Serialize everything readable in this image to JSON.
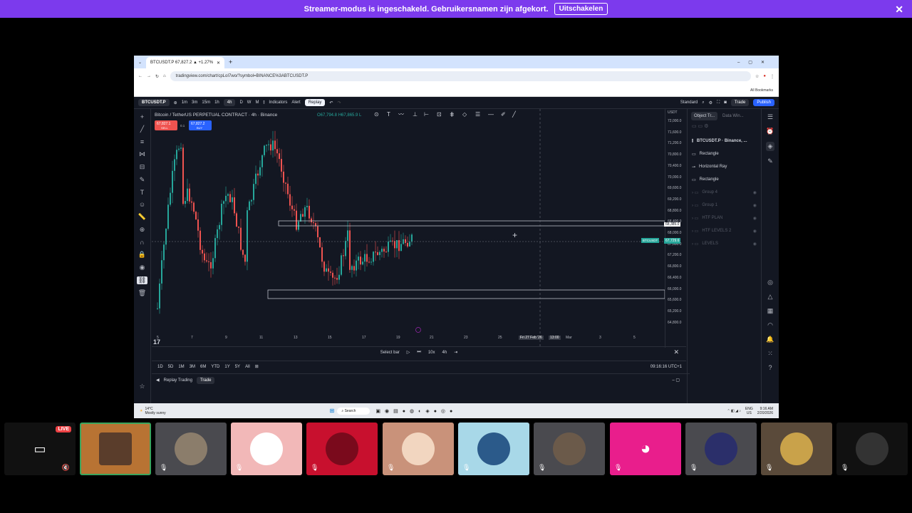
{
  "banner": {
    "text": "Streamer-modus is ingeschakeld. Gebruikersnamen zijn afgekort.",
    "button": "Uitschakelen"
  },
  "browser": {
    "tab_title": "BTCUSDT.P 67,827.2 ▲ +1.27%",
    "url": "tradingview.com/chart/cpLoI7wo/?symbol=BINANCE%3ABTCUSDT.P",
    "bookmarks": "All Bookmarks"
  },
  "toolbar": {
    "symbol": "BTCUSDT.P",
    "intervals": [
      "1m",
      "3m",
      "15m",
      "1h",
      "4h",
      "D",
      "W",
      "M"
    ],
    "indicators": "Indicators",
    "alert": "Alert",
    "replay": "Replay",
    "layout": "Standard",
    "trade": "Trade",
    "publish": "Publish"
  },
  "chart": {
    "title": "Bitcoin / TetherUS PERPETUAL CONTRACT · 4h · Binance",
    "ohlc": "O67,794.8 H67,865.9 L",
    "sell_price": "67,827.1",
    "sell_label": "SELL",
    "spread": "0.1",
    "buy_price": "67,827.2",
    "buy_label": "BUY",
    "currency": "USDT",
    "marker_price": "68,385.0",
    "current_price": "67,729.6",
    "current_symbol": "BTCUSDT",
    "crosshair_date": "Fri 27 Feb '26",
    "crosshair_time": "13:00"
  },
  "price_ticks": [
    "72,000.0",
    "71,600.0",
    "71,200.0",
    "70,800.0",
    "70,400.0",
    "70,000.0",
    "69,600.0",
    "69,200.0",
    "68,800.0",
    "68,400.0",
    "68,000.0",
    "67,600.0",
    "67,200.0",
    "66,800.0",
    "66,400.0",
    "66,000.0",
    "65,600.0",
    "65,200.0",
    "64,800.0"
  ],
  "time_ticks": [
    "5",
    "7",
    "9",
    "11",
    "13",
    "15",
    "17",
    "19",
    "21",
    "23",
    "25",
    "Mar",
    "3",
    "5"
  ],
  "replay": {
    "select_bar": "Select bar",
    "speed": "10x",
    "interval": "4h"
  },
  "ranges": [
    "1D",
    "5D",
    "1M",
    "3M",
    "6M",
    "YTD",
    "1Y",
    "5Y",
    "All"
  ],
  "clock": "09:16:16 UTC+1",
  "bottom_panel": {
    "label": "Replay Trading",
    "button": "Trade"
  },
  "object_tree": {
    "tabs": [
      "Object Tr...",
      "Data Win..."
    ],
    "header": "BTCUSDT.P · Binance, ...",
    "items": [
      "Rectangle",
      "Horizontal Ray",
      "Rectangle"
    ],
    "groups": [
      "Group 4",
      "Group 1",
      "HTF PLAN",
      "HTF LEVELS 2",
      "LEVELS"
    ]
  },
  "taskbar": {
    "temp": "14°C",
    "weather": "Mostly sunny",
    "search": "Search",
    "lang": "ENG",
    "region": "US",
    "time": "9:16 AM",
    "date": "2/20/2026"
  },
  "discord": {
    "live": "LIVE"
  },
  "colors": {
    "up": "#26a69a",
    "down": "#ef5350",
    "banner": "#7c3aed"
  }
}
